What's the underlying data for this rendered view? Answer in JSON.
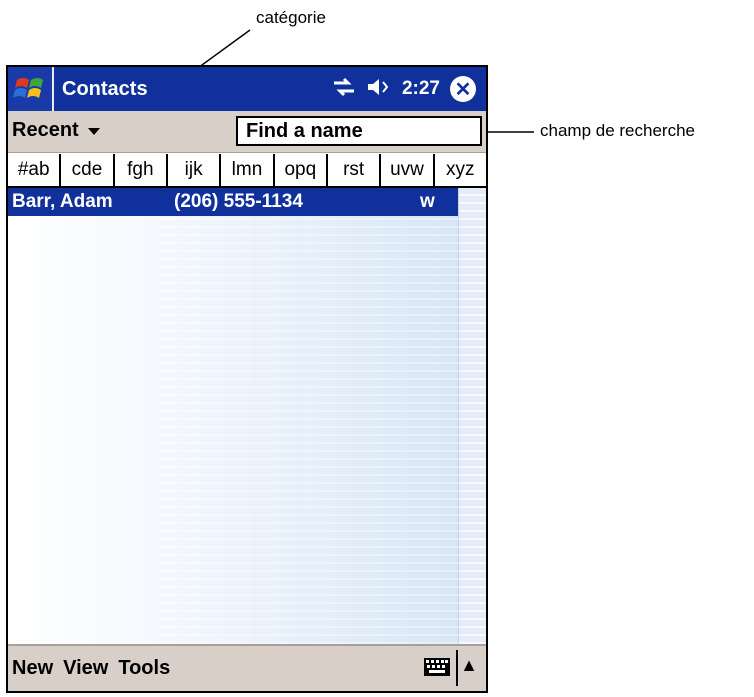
{
  "annotations": {
    "category": "catégorie",
    "search_field": "champ de recherche"
  },
  "title_bar": {
    "app_title": "Contacts",
    "time": "2:27",
    "icons": [
      "windows-start-icon",
      "sync-arrows-icon",
      "speaker-icon",
      "close-icon"
    ]
  },
  "category_bar": {
    "selected_category": "Recent",
    "find_placeholder": "Find a name"
  },
  "alphabet_tabs": [
    "#ab",
    "cde",
    "fgh",
    "ijk",
    "lmn",
    "opq",
    "rst",
    "uvw",
    "xyz"
  ],
  "contacts": [
    {
      "name": "Barr, Adam",
      "phone": "(206) 555-1134",
      "type": "w",
      "selected": true
    }
  ],
  "menu": {
    "items": [
      "New",
      "View",
      "Tools"
    ]
  },
  "colors": {
    "title_bar": "#10309c",
    "selection": "#10309c",
    "bar_background": "#d8d0c8"
  }
}
